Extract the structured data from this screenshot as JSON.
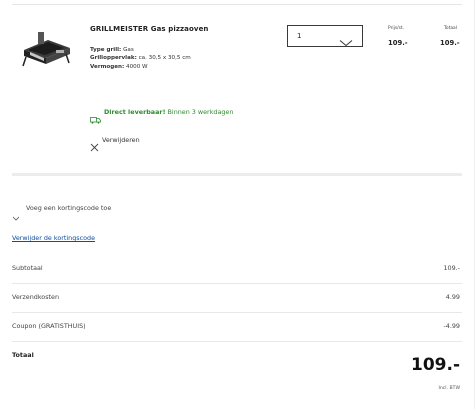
{
  "product": {
    "title": "GRILLMEISTER Gas pizzaoven",
    "image_icon": "pizza-oven-image",
    "specs": [
      {
        "label": "Type grill:",
        "value": " Gas"
      },
      {
        "label": "Grilloppervlak:",
        "value": " ca. 30,5 x 30,5 cm"
      },
      {
        "label": "Vermogen:",
        "value": " 4000 W"
      }
    ],
    "quantity": "1",
    "price_header": "Prijs/st.",
    "price": "109.-",
    "total_header": "Totaal",
    "total": "109.-",
    "delivery_bold": "Direct leverbaar!",
    "delivery_text": " Binnen 3 werkdagen",
    "remove_label": "Verwijderen"
  },
  "discount": {
    "toggle_label": "Voeg een kortingscode toe",
    "remove_label": "Verwijder de kortingscode"
  },
  "summary": {
    "rows": [
      {
        "label": "Subtotaal",
        "value": "109.-"
      },
      {
        "label": "Verzendkosten",
        "value": "4.99"
      },
      {
        "label": "Coupon (GRATISTHUIS)",
        "value": "-4.99"
      }
    ],
    "total_label": "Totaal",
    "total_value": "109.-",
    "vat_note": "Incl. BTW"
  },
  "colors": {
    "green": "#2e8b2e",
    "link": "#0a4ea3"
  }
}
